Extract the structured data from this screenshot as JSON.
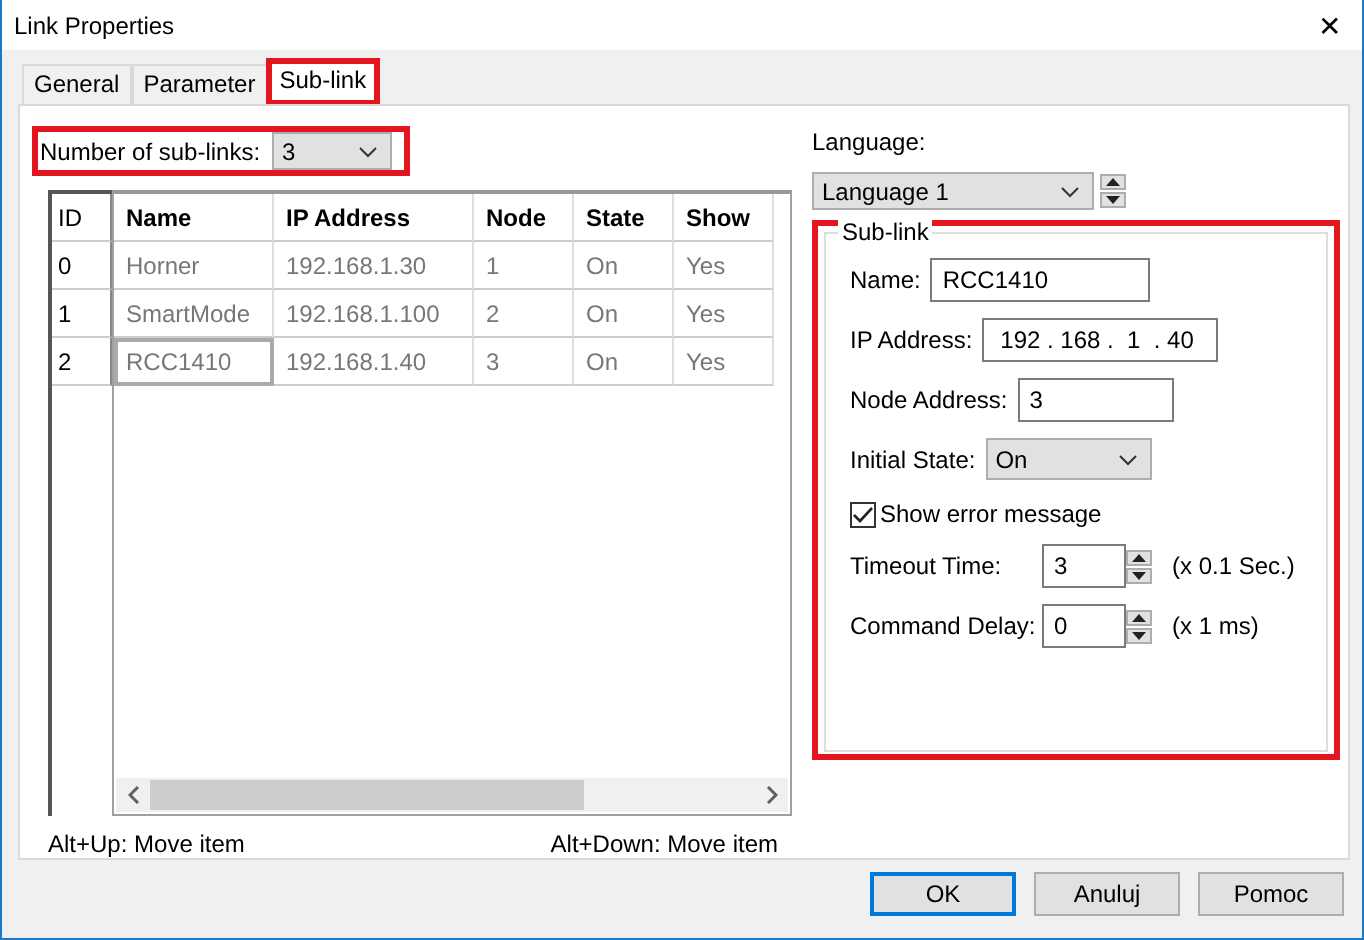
{
  "window": {
    "title": "Link Properties",
    "close": "✕"
  },
  "tabs": [
    {
      "label": "General",
      "selected": false,
      "highlighted": false
    },
    {
      "label": "Parameter",
      "selected": false,
      "highlighted": false
    },
    {
      "label": "Sub-link",
      "selected": true,
      "highlighted": true
    }
  ],
  "sub_link_count": {
    "label": "Number of sub-links:",
    "value": "3",
    "highlighted": true
  },
  "table": {
    "columns": [
      "ID",
      "Name",
      "IP Address",
      "Node",
      "State",
      "Show"
    ],
    "rows": [
      {
        "cells": [
          "0",
          "Horner",
          "192.168.1.30",
          "1",
          "On",
          "Yes"
        ],
        "focused": false
      },
      {
        "cells": [
          "1",
          "SmartMode",
          "192.168.1.100",
          "2",
          "On",
          "Yes"
        ],
        "focused": false
      },
      {
        "cells": [
          "2",
          "RCC1410",
          "192.168.1.40",
          "3",
          "On",
          "Yes"
        ],
        "focused": true
      }
    ],
    "hints": [
      "Alt+Up: Move item",
      "Alt+Down: Move item"
    ]
  },
  "language": {
    "label": "Language:",
    "value": "Language 1"
  },
  "sub_link": {
    "title": "Sub-link",
    "highlighted": true,
    "name": {
      "label": "Name:",
      "value": "RCC1410"
    },
    "ip": {
      "label": "IP Address:",
      "value": "192 . 168 .  1  . 40"
    },
    "node": {
      "label": "Node Address:",
      "value": "3"
    },
    "initial_state": {
      "label": "Initial State:",
      "value": "On"
    },
    "show_error": {
      "label": "Show error message",
      "checked": true
    },
    "timeout": {
      "label": "Timeout Time:",
      "value": "3",
      "unit": "(x 0.1 Sec.)"
    },
    "command_delay": {
      "label": "Command Delay:",
      "value": "0",
      "unit": "(x 1 ms)"
    }
  },
  "buttons": [
    {
      "label": "OK",
      "default": true
    },
    {
      "label": "Anuluj",
      "default": false
    },
    {
      "label": "Pomoc",
      "default": false
    }
  ]
}
